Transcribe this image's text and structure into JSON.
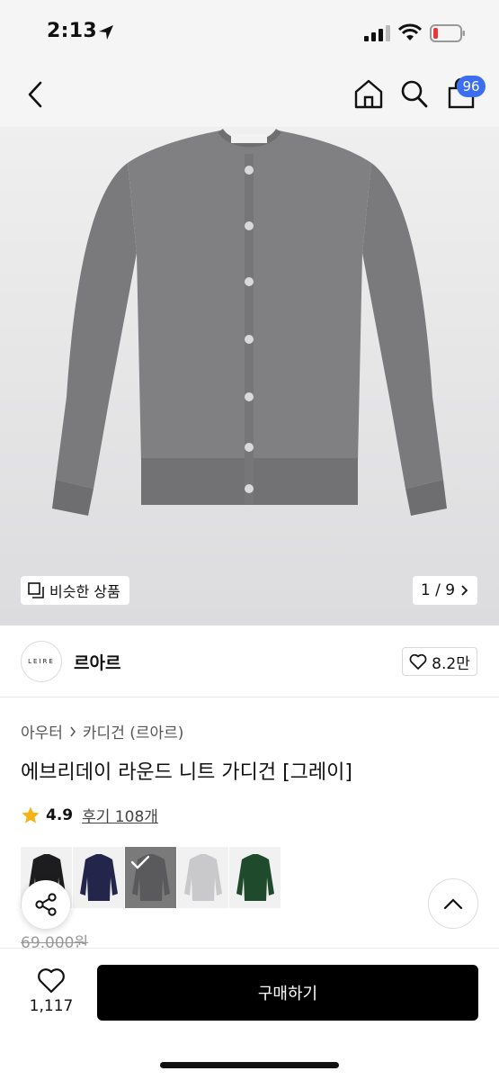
{
  "status_bar": {
    "time": "2:13"
  },
  "header": {
    "cart_count": "96"
  },
  "hero": {
    "similar_label": "비슷한 상품",
    "pager": "1 / 9"
  },
  "brand": {
    "logo_text": "LEIRE",
    "name": "르아르",
    "likes": "8.2만"
  },
  "breadcrumb": {
    "items": [
      "아우터",
      "카디건 (르아르)"
    ]
  },
  "product": {
    "title": "에브리데이 라운드 니트 가디건 [그레이]",
    "rating": "4.9",
    "reviews": "후기 108개",
    "original_price": "69,000원"
  },
  "swatches": [
    {
      "color": "#1d1d1f",
      "selected": false
    },
    {
      "color": "#23264a",
      "selected": false
    },
    {
      "color": "#5a5a5c",
      "selected": true
    },
    {
      "color": "#c9c9cb",
      "selected": false
    },
    {
      "color": "#1f4a2c",
      "selected": false
    }
  ],
  "bottom": {
    "like_count": "1,117",
    "buy_label": "구매하기"
  },
  "colors": {
    "accent": "#3b6ef0",
    "star": "#f6b312",
    "buy_button": "#000000",
    "cardigan": "#7e7e80"
  }
}
